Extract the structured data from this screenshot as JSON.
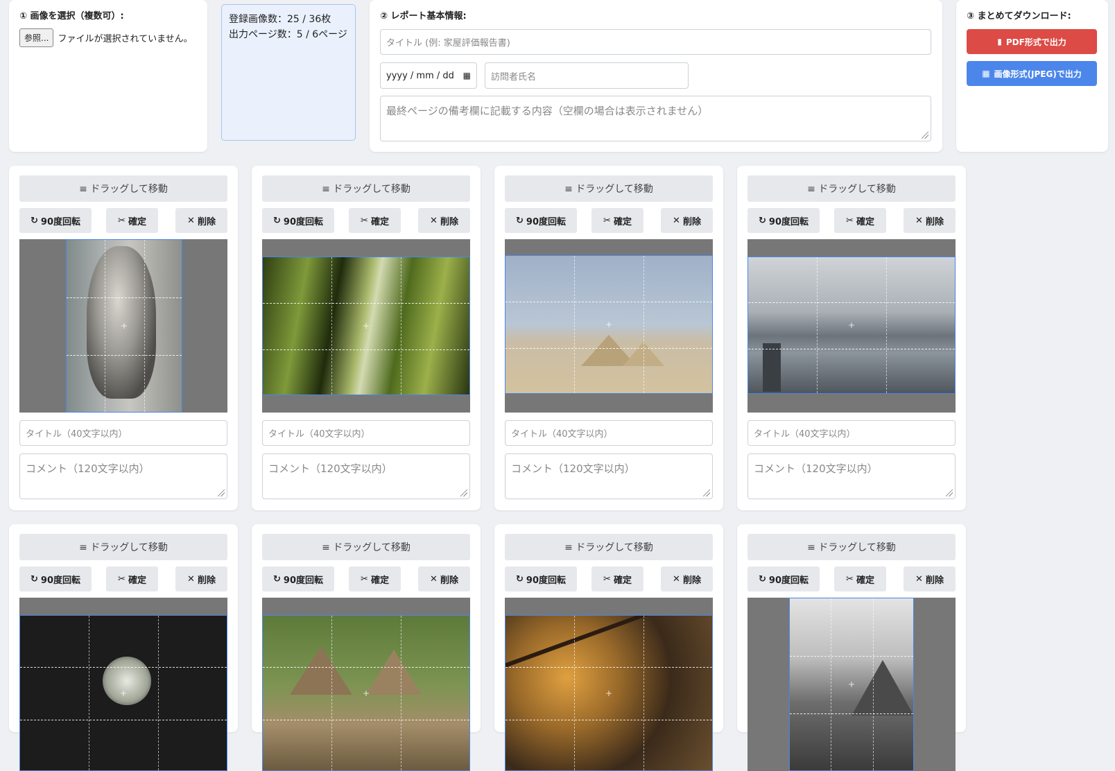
{
  "select": {
    "label": "① 画像を選択（複数可）:",
    "browse": "参照...",
    "no_file": "ファイルが選択されていません。"
  },
  "counts": {
    "images": "登録画像数：25 / 36枚",
    "pages": "出力ページ数：5 / 6ページ"
  },
  "report": {
    "label": "② レポート基本情報:",
    "title_placeholder": "タイトル (例: 家屋評価報告書)",
    "date_placeholder": "yyyy / mm / dd",
    "visitor_placeholder": "訪問者氏名",
    "note_placeholder": "最終ページの備考欄に記載する内容（空欄の場合は表示されません）"
  },
  "download": {
    "label": "③ まとめてダウンロード:",
    "pdf": "PDF形式で出力",
    "jpeg": "画像形式(JPEG)で出力",
    "pdf_color": "#dc4b45",
    "jpeg_color": "#4c86ea"
  },
  "card_ui": {
    "drag": "≡ ドラッグして移動",
    "rotate": "90度回転",
    "confirm": "確定",
    "delete": "削除",
    "title_placeholder": "タイトル（40文字以内）",
    "comment_placeholder": "コメント（120文字以内）"
  },
  "icons": [
    "rotate-icon",
    "scissors-icon",
    "close-icon",
    "pdf-file-icon",
    "image-icon",
    "calendar-icon"
  ]
}
